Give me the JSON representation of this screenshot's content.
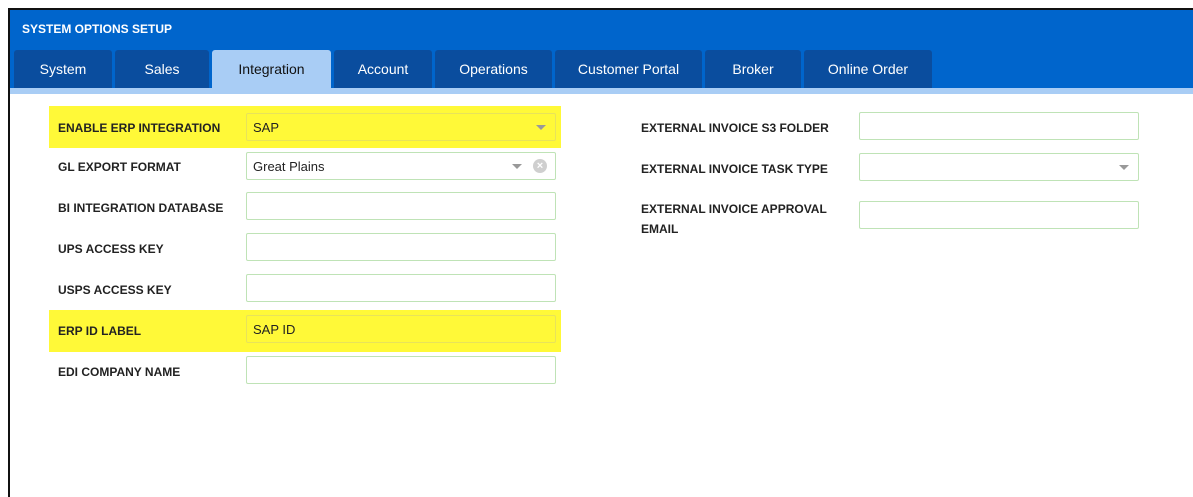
{
  "window": {
    "title": "SYSTEM OPTIONS SETUP"
  },
  "tabs": [
    {
      "label": "System"
    },
    {
      "label": "Sales"
    },
    {
      "label": "Integration",
      "active": true
    },
    {
      "label": "Account"
    },
    {
      "label": "Operations"
    },
    {
      "label": "Customer Portal"
    },
    {
      "label": "Broker"
    },
    {
      "label": "Online Order"
    }
  ],
  "left_fields": {
    "enable_erp": {
      "label": "ENABLE ERP INTEGRATION",
      "value": "SAP"
    },
    "gl_export": {
      "label": "GL EXPORT FORMAT",
      "value": "Great Plains"
    },
    "bi_db": {
      "label": "BI INTEGRATION DATABASE",
      "value": ""
    },
    "ups_key": {
      "label": "UPS ACCESS KEY",
      "value": ""
    },
    "usps_key": {
      "label": "USPS ACCESS KEY",
      "value": ""
    },
    "erp_id_label": {
      "label": "ERP ID LABEL",
      "value": "SAP ID"
    },
    "edi_company": {
      "label": "EDI COMPANY NAME",
      "value": ""
    }
  },
  "right_fields": {
    "s3_folder": {
      "label": "EXTERNAL INVOICE S3 FOLDER",
      "value": ""
    },
    "task_type": {
      "label": "EXTERNAL INVOICE TASK TYPE",
      "value": ""
    },
    "approval_email": {
      "label_line1": "EXTERNAL INVOICE APPROVAL",
      "label_line2": "EMAIL",
      "value": ""
    }
  },
  "colors": {
    "header_blue": "#0065cc",
    "tab_dark": "#0a4d9e",
    "tab_active": "#a9cdf5",
    "highlight_yellow": "#fff938",
    "field_border": "#bfe3b6"
  }
}
